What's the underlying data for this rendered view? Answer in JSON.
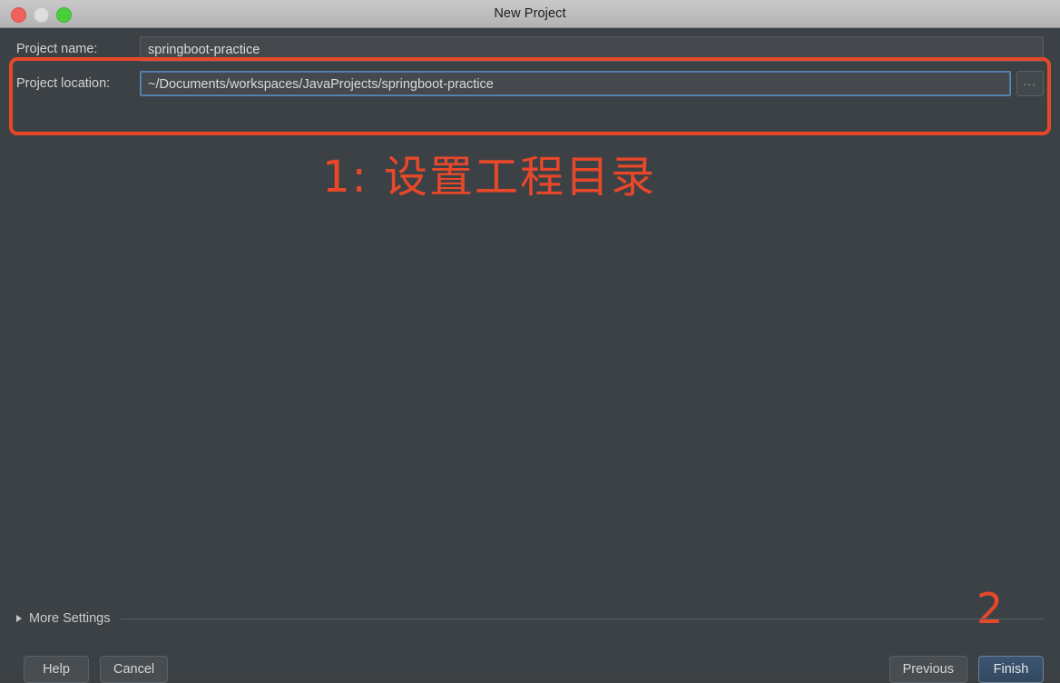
{
  "window": {
    "title": "New Project",
    "traffic_lights": [
      "close",
      "minimize",
      "maximize"
    ]
  },
  "form": {
    "rows": [
      {
        "label": "Project name:",
        "value": "springboot-practice",
        "focused": false,
        "has_browse": false
      },
      {
        "label": "Project location:",
        "value": "~/Documents/workspaces/JavaProjects/springboot-practice",
        "focused": true,
        "has_browse": true,
        "browse_label": "..."
      }
    ]
  },
  "more_settings": {
    "label": "More Settings",
    "expanded": false
  },
  "footer": {
    "help_label": "Help",
    "cancel_label": "Cancel",
    "previous_label": "Previous",
    "finish_label": "Finish"
  },
  "annotations": {
    "step1_text": "1:  设置工程目录",
    "step2_text": "2",
    "color": "#e8482a"
  },
  "colors": {
    "dialog_background": "#3c4145",
    "titlebar": "#bdbdbd",
    "input_background": "#45494d",
    "focus_border": "#5b87b5",
    "primary_button": "#3b5573",
    "annotation": "#e8482a"
  }
}
